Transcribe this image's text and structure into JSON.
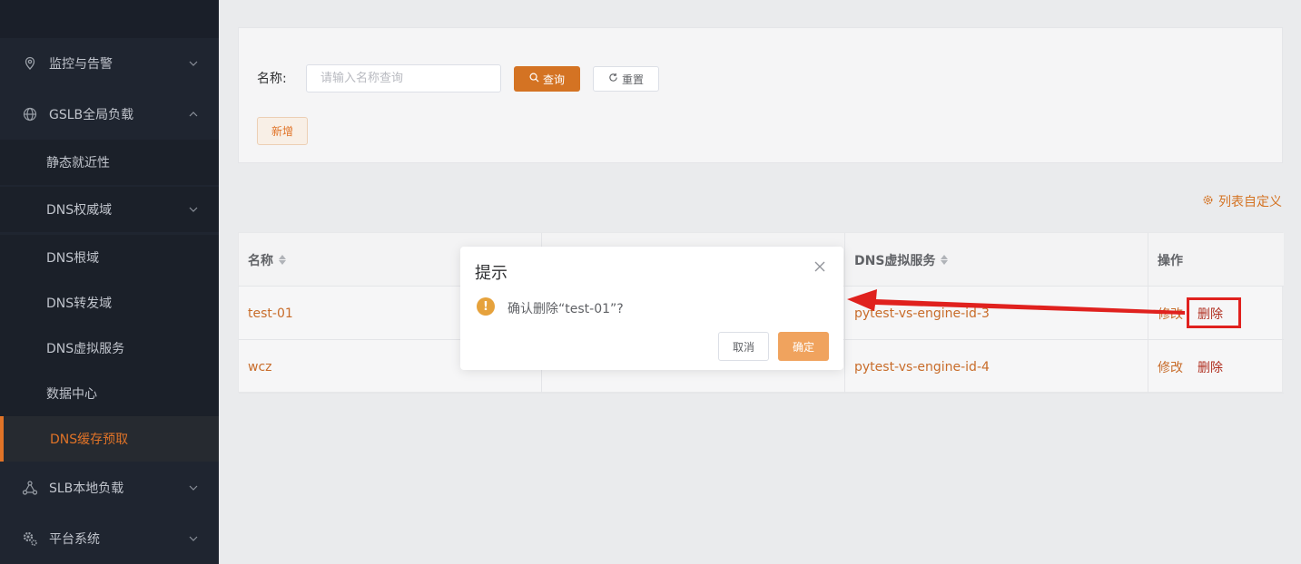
{
  "sidebar": {
    "items": [
      {
        "label": "监控与告警",
        "icon": "monitor-location-icon"
      },
      {
        "label": "GSLB全局负载",
        "icon": "globe-icon"
      }
    ],
    "sub_items": [
      {
        "label": "静态就近性"
      },
      {
        "label": "DNS权威域"
      },
      {
        "label": "DNS根域"
      },
      {
        "label": "DNS转发域"
      },
      {
        "label": "DNS虚拟服务"
      },
      {
        "label": "数据中心"
      },
      {
        "label": "DNS缓存预取"
      }
    ],
    "bottom_items": [
      {
        "label": "SLB本地负载",
        "icon": "network-nodes-icon"
      },
      {
        "label": "平台系统",
        "icon": "gear-icon"
      }
    ]
  },
  "search": {
    "label": "名称:",
    "placeholder": "请输入名称查询",
    "query_label": "查询",
    "reset_label": "重置",
    "add_label": "新增"
  },
  "toolbar": {
    "column_custom_label": "列表自定义"
  },
  "table": {
    "headers": [
      "名称",
      "",
      "DNS虚拟服务",
      "操作"
    ],
    "rows": [
      {
        "name": "test-01",
        "col2": "",
        "vs": "pytest-vs-engine-id-3",
        "edit": "修改",
        "delete": "删除"
      },
      {
        "name": "wcz",
        "col2": "",
        "vs": "pytest-vs-engine-id-4",
        "edit": "修改",
        "delete": "删除"
      }
    ]
  },
  "modal": {
    "title": "提示",
    "message": "确认删除“test-01”?",
    "cancel_label": "取消",
    "confirm_label": "确定"
  },
  "colors": {
    "accent": "#d47323",
    "sidebar_bg": "#1f2530",
    "annotation": "#e0211e"
  }
}
